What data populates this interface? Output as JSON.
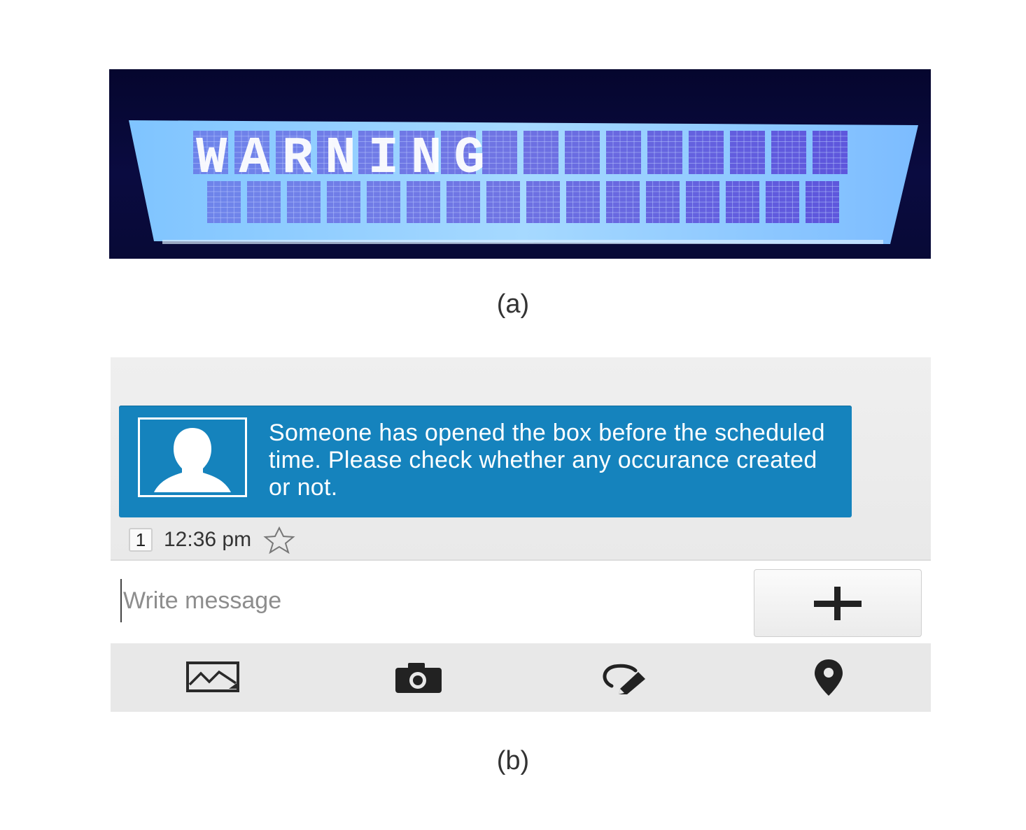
{
  "panel_a": {
    "lcd_text": "WARNING",
    "caption": "(a)"
  },
  "panel_b": {
    "message": {
      "text": "Someone has opened the box before the scheduled time. Please check whether any occurance created or not.",
      "sim_slot": "1",
      "time": "12:36 pm"
    },
    "compose": {
      "placeholder": "Write message"
    },
    "toolbar_icons": [
      "image-icon",
      "camera-icon",
      "handwriting-icon",
      "location-pin-icon"
    ],
    "caption": "(b)"
  },
  "colors": {
    "bubble": "#1583bd",
    "lcd_backlight": "#8ec6ff",
    "lcd_pixel": "#5a4bd8"
  }
}
